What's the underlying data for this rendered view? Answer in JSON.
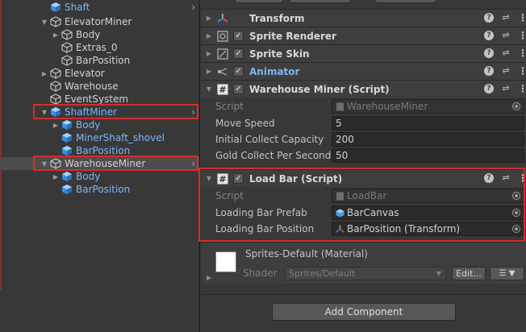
{
  "hierarchy": {
    "items": [
      {
        "label": "Shaft",
        "color": "blue",
        "indent": 1,
        "arrow": "none",
        "chev": true
      },
      {
        "label": "ElevatorMiner",
        "color": "white",
        "indent": 1,
        "arrow": "down",
        "chev": false
      },
      {
        "label": "Body",
        "color": "white",
        "indent": 2,
        "arrow": "right",
        "chev": false
      },
      {
        "label": "Extras_0",
        "color": "white",
        "indent": 2,
        "arrow": "none",
        "chev": false
      },
      {
        "label": "BarPosition",
        "color": "white",
        "indent": 2,
        "arrow": "none",
        "chev": false
      },
      {
        "label": "Elevator",
        "color": "white",
        "indent": 1,
        "arrow": "right",
        "chev": false
      },
      {
        "label": "Warehouse",
        "color": "white",
        "indent": 1,
        "arrow": "none",
        "chev": false
      },
      {
        "label": "EventSystem",
        "color": "white",
        "indent": 1,
        "arrow": "none",
        "chev": false
      },
      {
        "label": "ShaftMiner",
        "color": "blue",
        "indent": 1,
        "arrow": "down",
        "chev": true
      },
      {
        "label": "Body",
        "color": "blue",
        "indent": 2,
        "arrow": "right",
        "chev": false
      },
      {
        "label": "MinerShaft_shovel",
        "color": "blue",
        "indent": 2,
        "arrow": "none",
        "chev": false
      },
      {
        "label": "BarPosition",
        "color": "blue",
        "indent": 2,
        "arrow": "none",
        "chev": false
      },
      {
        "label": "WarehouseMiner",
        "color": "white",
        "indent": 1,
        "arrow": "down",
        "chev": true,
        "selected": true
      },
      {
        "label": "Body",
        "color": "blue",
        "indent": 2,
        "arrow": "right",
        "chev": false
      },
      {
        "label": "BarPosition",
        "color": "blue",
        "indent": 2,
        "arrow": "none",
        "chev": false
      }
    ]
  },
  "inspector": {
    "components": {
      "transform": "Transform",
      "sprite_renderer": "Sprite Renderer",
      "sprite_skin": "Sprite Skin",
      "animator": "Animator",
      "warehouse_miner": "Warehouse Miner (Script)",
      "load_bar": "Load Bar (Script)"
    },
    "warehouse_miner": {
      "script_label": "Script",
      "script_value": "WarehouseMiner",
      "move_speed_label": "Move Speed",
      "move_speed_value": "5",
      "initial_capacity_label": "Initial Collect Capacity",
      "initial_capacity_value": "200",
      "gold_per_second_label": "Gold Collect Per Second",
      "gold_per_second_value": "50"
    },
    "load_bar": {
      "script_label": "Script",
      "script_value": "LoadBar",
      "prefab_label": "Loading Bar Prefab",
      "prefab_value": "BarCanvas",
      "position_label": "Loading Bar Position",
      "position_value": "BarPosition (Transform)"
    },
    "material": {
      "name": "Sprites-Default (Material)",
      "shader_label": "Shader",
      "shader_value": "Sprites/Default",
      "edit_label": "Edit...",
      "list_icon": "☰"
    },
    "add_component_label": "Add Component",
    "colors": {
      "highlight_red": "#d92b2b",
      "blue_label": "#7eb6f4",
      "check": "✓"
    }
  }
}
